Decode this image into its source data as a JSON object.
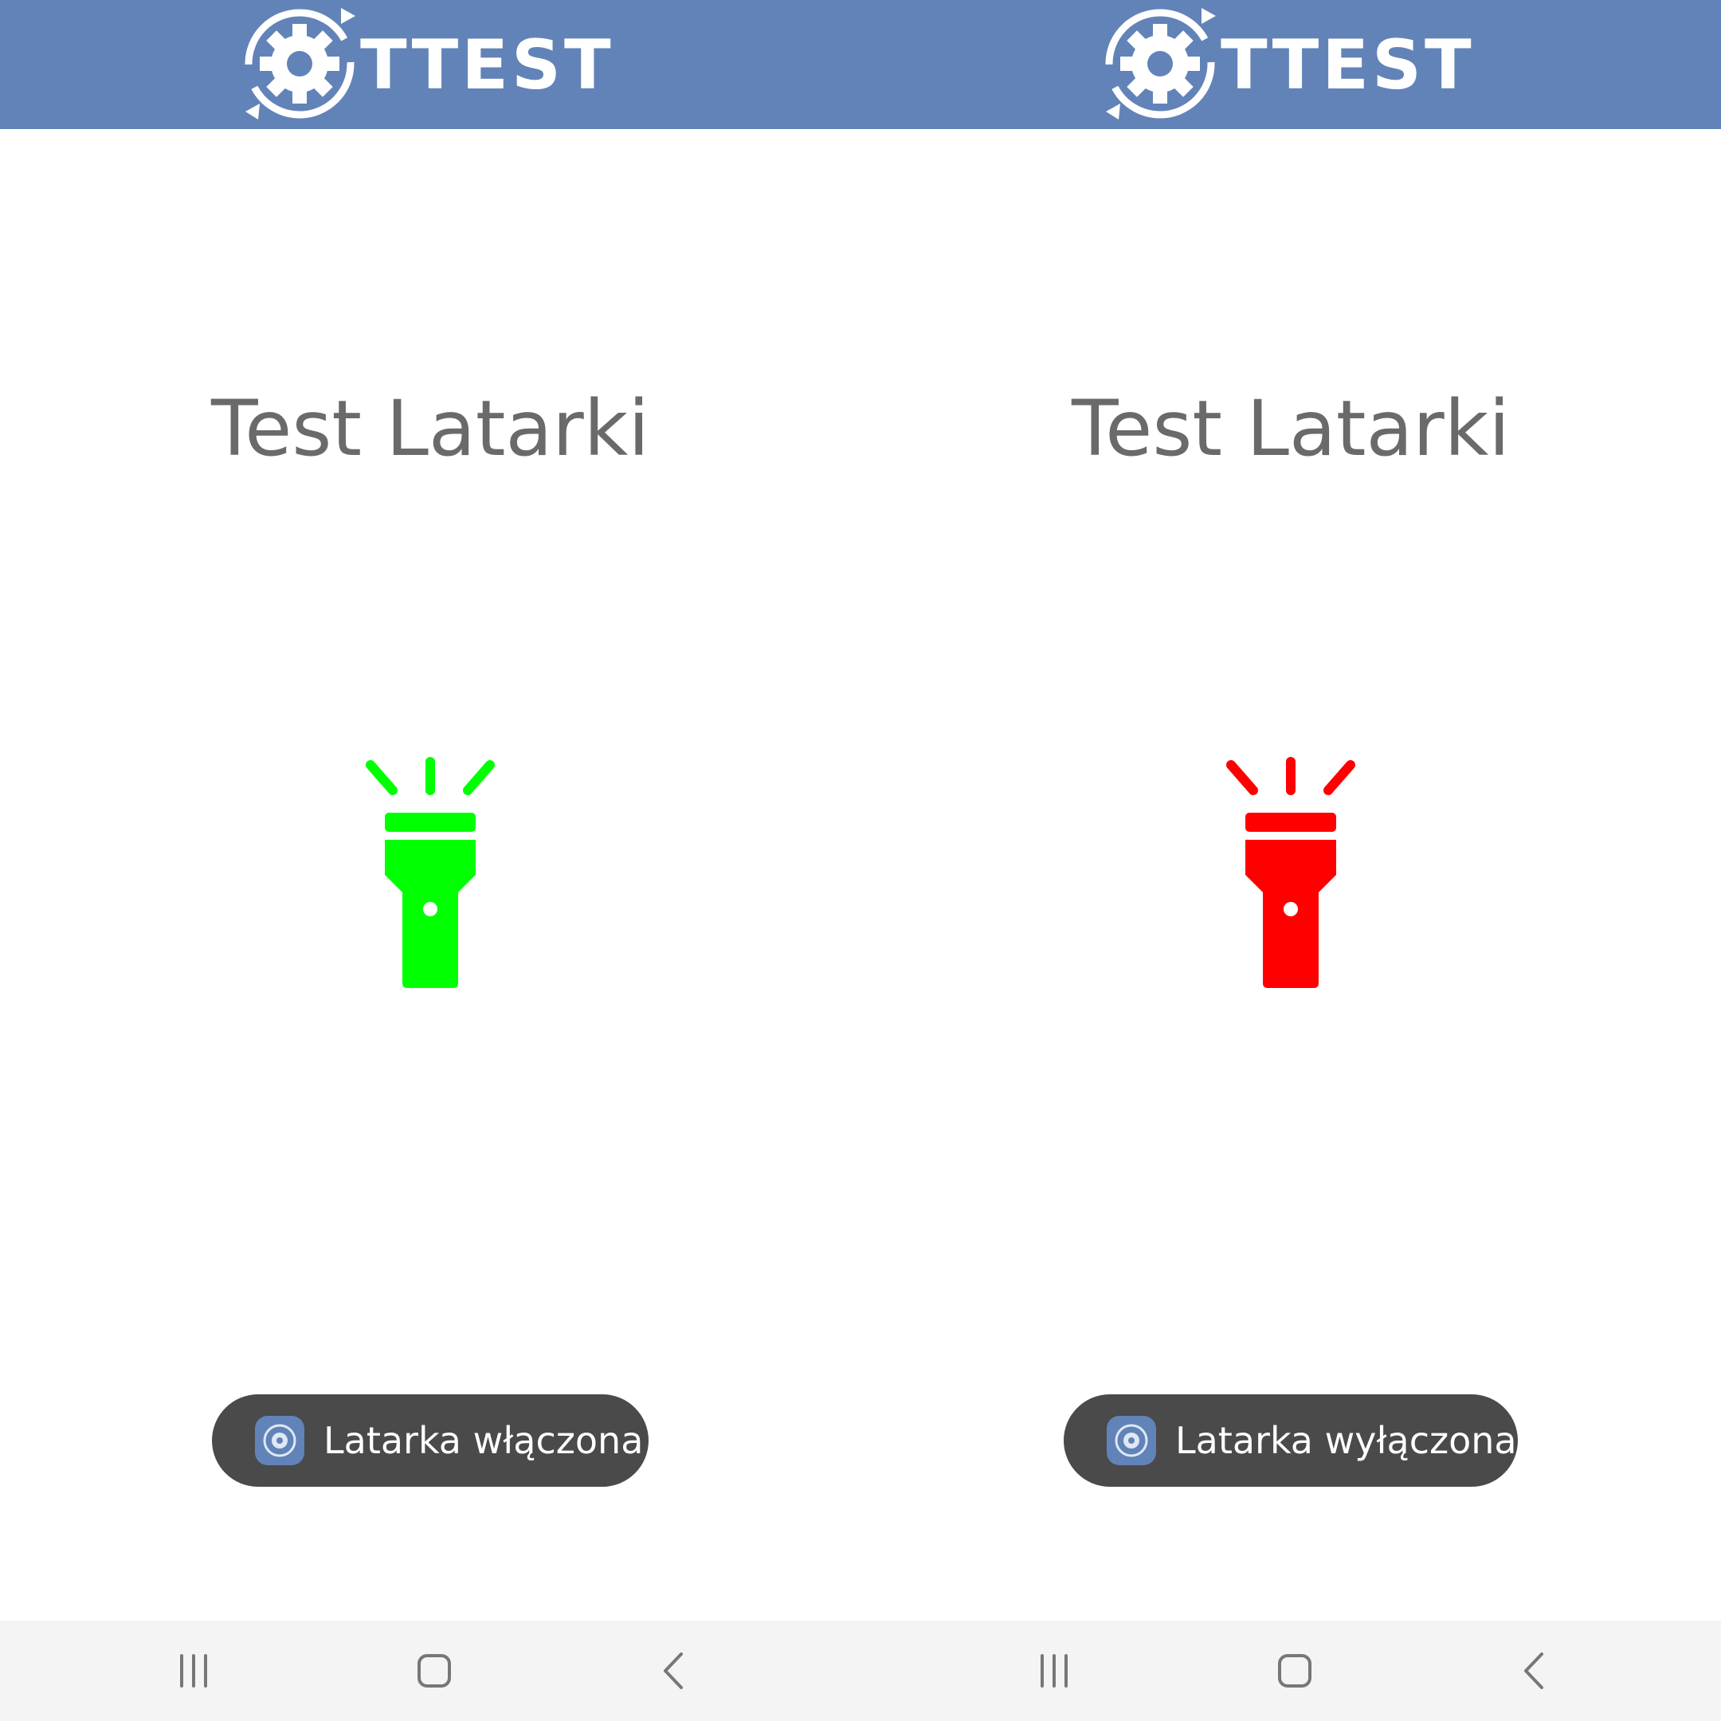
{
  "colors": {
    "header_bg": "#6283b8",
    "title_text": "#6a6a6a",
    "torch_on": "#00ff00",
    "torch_off": "#ff0000",
    "toast_bg": "#4a4a4a",
    "navbar_bg": "#f4f4f4",
    "nav_icon": "#777777"
  },
  "panels": [
    {
      "header": {
        "logo_text": "TTEST",
        "logo_icon": "gear-refresh-logo-icon"
      },
      "title": "Test Latarki",
      "torch": {
        "state": "on",
        "color": "#00ff00",
        "icon": "flashlight-icon"
      },
      "toast": {
        "text": "Latarka włączona",
        "icon": "app-icon"
      },
      "navbar": {
        "recents": "recent-apps-icon",
        "home": "home-icon",
        "back": "back-icon"
      }
    },
    {
      "header": {
        "logo_text": "TTEST",
        "logo_icon": "gear-refresh-logo-icon"
      },
      "title": "Test Latarki",
      "torch": {
        "state": "off",
        "color": "#ff0000",
        "icon": "flashlight-icon"
      },
      "toast": {
        "text": "Latarka wyłączona",
        "icon": "app-icon"
      },
      "navbar": {
        "recents": "recent-apps-icon",
        "home": "home-icon",
        "back": "back-icon"
      }
    }
  ]
}
